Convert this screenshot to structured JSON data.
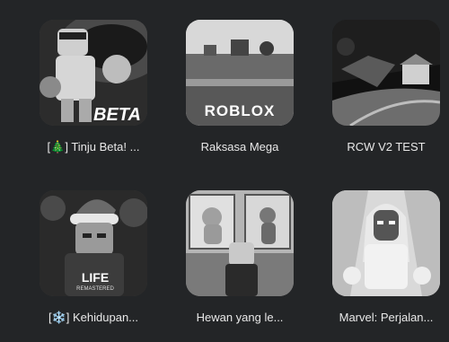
{
  "games": [
    {
      "title": "[🎄] Tinju Beta! ...",
      "thumb_text": "BETA",
      "thumb": "boxer-avatar"
    },
    {
      "title": "Raksasa Mega",
      "thumb_text": "ROBLOX",
      "thumb": "grass-field"
    },
    {
      "title": "RCW V2 TEST",
      "thumb_text": "",
      "thumb": "night-road"
    },
    {
      "title": "[❄️] Kehidupan...",
      "thumb_text": "LIFE",
      "thumb_subtext": "REMASTERED",
      "thumb": "santa-avatar"
    },
    {
      "title": "Hewan yang le...",
      "thumb_text": "",
      "thumb": "pet-gallery"
    },
    {
      "title": "Marvel: Perjalan...",
      "thumb_text": "",
      "thumb": "marvel-avatar"
    }
  ]
}
